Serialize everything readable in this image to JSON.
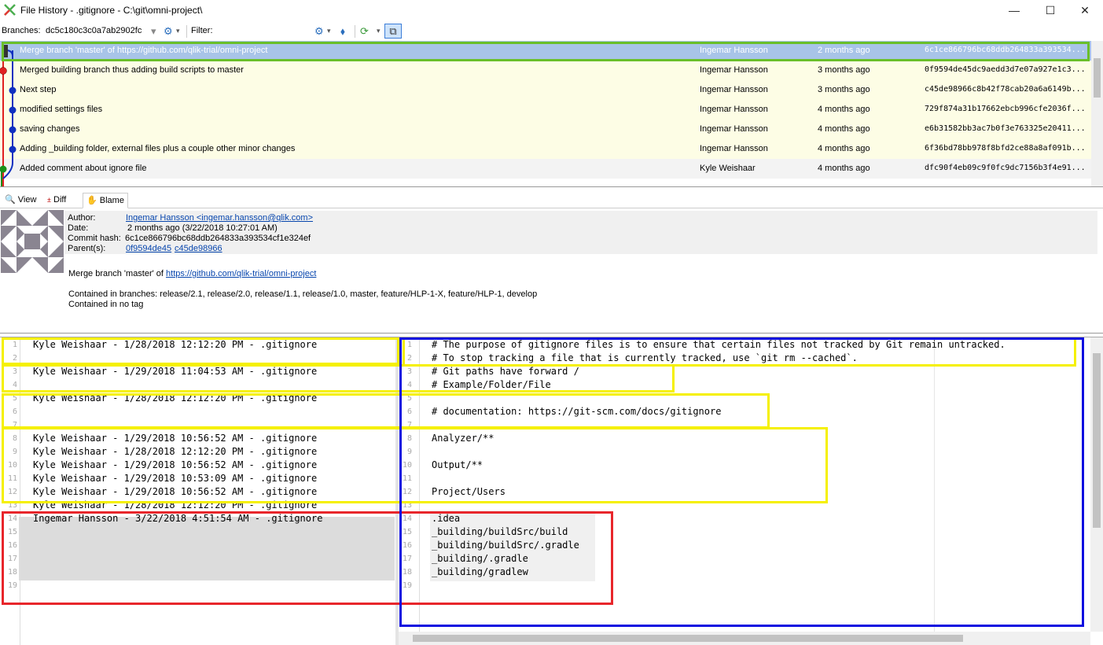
{
  "window": {
    "title": "File History - .gitignore - C:\\git\\omni-project\\",
    "minimize": "—",
    "maximize": "☐",
    "close": "✕"
  },
  "toolbar": {
    "branches_label": "Branches:",
    "branch_value": "dc5c180c3c0a7ab2902fc",
    "filter_label": "Filter:"
  },
  "commits": [
    {
      "message": "Merge branch 'master' of https://github.com/qlik-trial/omni-project",
      "author": "Ingemar Hansson",
      "date": "2 months ago",
      "hash": "6c1ce866796bc68ddb264833a393534...",
      "selected": true,
      "bg": "#a8c4e8"
    },
    {
      "message": "Merged building branch thus adding build scripts to master",
      "author": "Ingemar Hansson",
      "date": "3 months ago",
      "hash": "0f9594de45dc9aedd3d7e07a927e1c3...",
      "bg": "#fdfde5"
    },
    {
      "message": "Next step",
      "author": "Ingemar Hansson",
      "date": "3 months ago",
      "hash": "c45de98966c8b42f78cab20a6a6149b...",
      "bg": "#fdfde5"
    },
    {
      "message": "modified settings files",
      "author": "Ingemar Hansson",
      "date": "4 months ago",
      "hash": "729f874a31b17662ebcb996cfe2036f...",
      "bg": "#fdfde5"
    },
    {
      "message": "saving changes",
      "author": "Ingemar Hansson",
      "date": "4 months ago",
      "hash": "e6b31582bb3ac7b0f3e763325e20411...",
      "bg": "#fdfde5"
    },
    {
      "message": "Adding _building folder, external files plus a couple other minor changes",
      "author": "Ingemar Hansson",
      "date": "4 months ago",
      "hash": "6f36bd78bb978f8bfd2ce88a8af091b...",
      "bg": "#fdfde5"
    },
    {
      "message": "Added comment about ignore file",
      "author": "Kyle Weishaar",
      "date": "4 months ago",
      "hash": "dfc90f4eb09c9f0fc9dc7156b3f4e91...",
      "bg": "#f3f3f3"
    }
  ],
  "tabs": [
    {
      "label": "View"
    },
    {
      "label": "Diff"
    },
    {
      "label": "Blame",
      "active": true
    }
  ],
  "commit_info": {
    "author_label": "Author:",
    "author_value": "Ingemar Hansson <ingemar.hansson@qlik.com>",
    "date_label": "Date:",
    "date_value": "2 months ago (3/22/2018 10:27:01 AM)",
    "hash_label": "Commit hash:",
    "hash_value": "6c1ce866796bc68ddb264833a393534cf1e324ef",
    "parents_label": "Parent(s):",
    "parent1": "0f9594de45",
    "parent2": "c45de98966",
    "message_prefix": "Merge branch 'master' of ",
    "message_link": "https://github.com/qlik-trial/omni-project",
    "branches_text": "Contained in branches: release/2.1, release/2.0, release/1.1, release/1.0, master, feature/HLP-1-X, feature/HLP-1, develop",
    "tags_text": "Contained in no tag"
  },
  "blame_left": [
    {
      "n": "1",
      "text": "Kyle Weishaar - 1/28/2018 12:12:20 PM - .gitignore"
    },
    {
      "n": "2",
      "text": ""
    },
    {
      "n": "3",
      "text": "Kyle Weishaar - 1/29/2018 11:04:53 AM - .gitignore"
    },
    {
      "n": "4",
      "text": ""
    },
    {
      "n": "5",
      "text": "Kyle Weishaar - 1/28/2018 12:12:20 PM - .gitignore"
    },
    {
      "n": "6",
      "text": ""
    },
    {
      "n": "7",
      "text": ""
    },
    {
      "n": "8",
      "text": "Kyle Weishaar - 1/29/2018 10:56:52 AM - .gitignore"
    },
    {
      "n": "9",
      "text": "Kyle Weishaar - 1/28/2018 12:12:20 PM - .gitignore"
    },
    {
      "n": "10",
      "text": "Kyle Weishaar - 1/29/2018 10:56:52 AM - .gitignore"
    },
    {
      "n": "11",
      "text": "Kyle Weishaar - 1/29/2018 10:53:09 AM - .gitignore"
    },
    {
      "n": "12",
      "text": "Kyle Weishaar - 1/29/2018 10:56:52 AM - .gitignore"
    },
    {
      "n": "13",
      "text": "Kyle Weishaar - 1/28/2018 12:12:20 PM - .gitignore"
    },
    {
      "n": "14",
      "text": "Ingemar Hansson - 3/22/2018 4:51:54 AM - .gitignore"
    },
    {
      "n": "15",
      "text": ""
    },
    {
      "n": "16",
      "text": ""
    },
    {
      "n": "17",
      "text": ""
    },
    {
      "n": "18",
      "text": ""
    },
    {
      "n": "19",
      "text": ""
    }
  ],
  "blame_right": [
    {
      "n": "1",
      "text": "# The purpose of gitignore files is to ensure that certain files not tracked by Git remain untracked."
    },
    {
      "n": "2",
      "text": "# To stop tracking a file that is currently tracked, use `git rm --cached`."
    },
    {
      "n": "3",
      "text": "# Git paths have forward /"
    },
    {
      "n": "4",
      "text": "# Example/Folder/File"
    },
    {
      "n": "5",
      "text": ""
    },
    {
      "n": "6",
      "text": "# documentation: https://git-scm.com/docs/gitignore"
    },
    {
      "n": "7",
      "text": ""
    },
    {
      "n": "8",
      "text": "Analyzer/**"
    },
    {
      "n": "9",
      "text": ""
    },
    {
      "n": "10",
      "text": "Output/**"
    },
    {
      "n": "11",
      "text": ""
    },
    {
      "n": "12",
      "text": "Project/Users"
    },
    {
      "n": "13",
      "text": ""
    },
    {
      "n": "14",
      "text": ".idea"
    },
    {
      "n": "15",
      "text": "_building/buildSrc/build"
    },
    {
      "n": "16",
      "text": "_building/buildSrc/.gradle"
    },
    {
      "n": "17",
      "text": "_building/.gradle"
    },
    {
      "n": "18",
      "text": "_building/gradlew"
    },
    {
      "n": "19",
      "text": ""
    }
  ],
  "colors": {
    "highlight_green": "#6abf2a",
    "highlight_yellow": "#f5f000",
    "highlight_red": "#e8262b",
    "highlight_blue": "#1010e0",
    "selected_row": "#a8c4e8",
    "link": "#0645ad"
  }
}
